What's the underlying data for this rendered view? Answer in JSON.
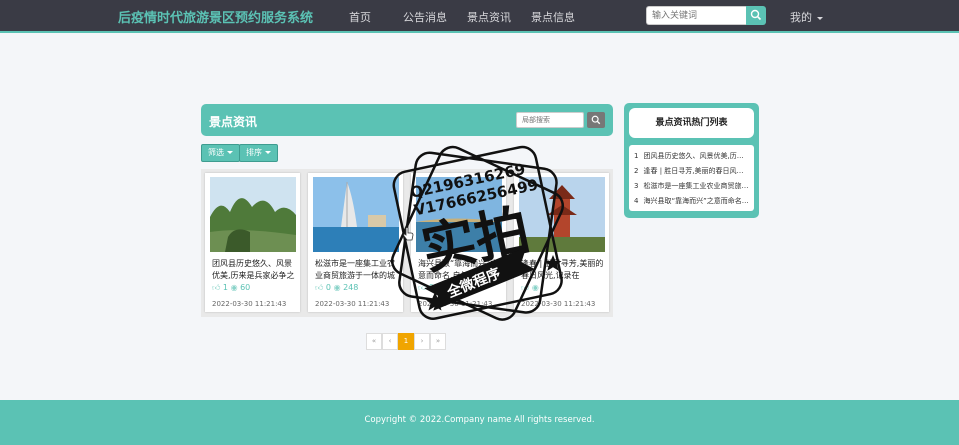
{
  "nav": {
    "brand": "后疫情时代旅游景区预约服务系统",
    "links": [
      "首页",
      "公告消息",
      "景点资讯",
      "景点信息"
    ],
    "search_placeholder": "输入关键词",
    "mine": "我的"
  },
  "colors": {
    "accent": "#5bc2b4",
    "nav_bg": "#3a3b45",
    "page_active": "#f0a500"
  },
  "main": {
    "title": "景点资讯",
    "local_search_placeholder": "局部搜索",
    "filter_label": "筛选",
    "sort_label": "排序",
    "cards": [
      {
        "title": "团风县历史悠久、风景优美,历来是兵家必争之地",
        "likes": "1",
        "views": "60",
        "date": "2022-03-30 11:21:43"
      },
      {
        "title": "松滋市是一座集工业农业商贸旅游于一体的城市",
        "likes": "0",
        "views": "248",
        "date": "2022-03-30 11:21:43"
      },
      {
        "title": "海兴县取“靠海而兴”之意而命名,自然风光",
        "likes": "0",
        "views": "",
        "date": "2022-03-30 11:21:43"
      },
      {
        "title": "逢春 | 胜日寻芳,美丽的春日风光,记录在",
        "likes": "",
        "views": "",
        "date": "2022-03-30 11:21:43"
      }
    ],
    "pagination": [
      "«",
      "‹",
      "1",
      "›",
      "»"
    ]
  },
  "sidebar": {
    "title": "景点资讯热门列表",
    "items": [
      {
        "num": "1",
        "text": "团风县历史悠久、风景优美,历来是兵家必争之地"
      },
      {
        "num": "2",
        "text": "逢春 | 胜日寻芳,美丽的春日风光,记录在"
      },
      {
        "num": "3",
        "text": "松滋市是一座集工业农业商贸旅游于一体的城市"
      },
      {
        "num": "4",
        "text": "海兴县取“靠海而兴”之意而命名,自然风光"
      }
    ]
  },
  "footer": {
    "copyright": "Copyright © 2022.Company name All rights reserved."
  },
  "stamp": {
    "contact_1": "Q2196316269",
    "contact_2": "V17666256499",
    "main_text": "实拍",
    "ribbon_text": "全微程序"
  }
}
